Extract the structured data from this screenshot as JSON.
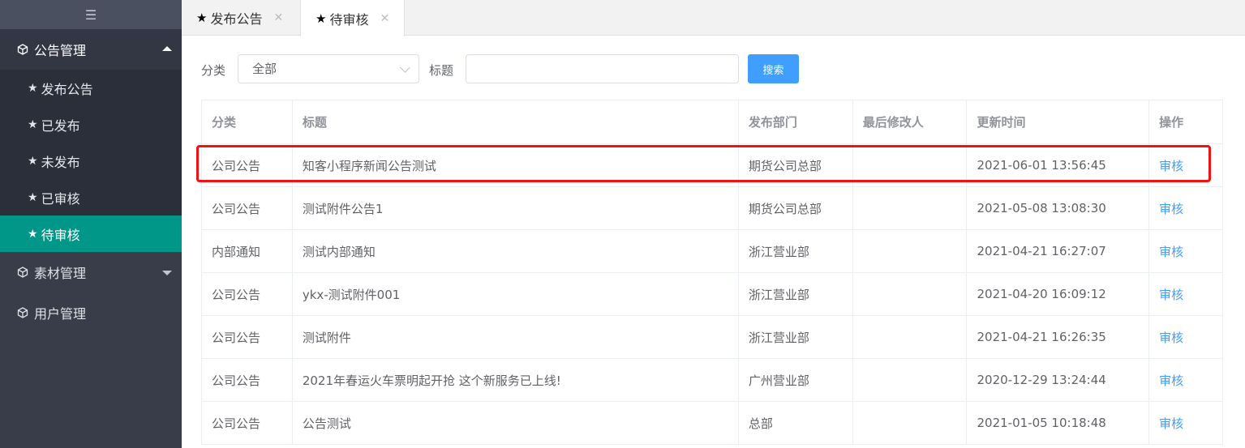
{
  "sidebar": {
    "toggle_icon": "menu-icon",
    "groups": [
      {
        "label": "公告管理",
        "icon": "cube-icon",
        "expanded": true,
        "items": [
          {
            "label": "发布公告",
            "icon": "star-icon"
          },
          {
            "label": "已发布",
            "icon": "star-icon"
          },
          {
            "label": "未发布",
            "icon": "star-icon"
          },
          {
            "label": "已审核",
            "icon": "star-icon"
          },
          {
            "label": "待审核",
            "icon": "star-icon",
            "active": true
          }
        ]
      },
      {
        "label": "素材管理",
        "icon": "cube-icon",
        "expanded": false
      },
      {
        "label": "用户管理",
        "icon": "cube-icon"
      }
    ]
  },
  "tabs": [
    {
      "label": "发布公告",
      "icon": "star-icon",
      "close": "✕"
    },
    {
      "label": "待审核",
      "icon": "star-icon",
      "close": "✕",
      "active": true
    }
  ],
  "search": {
    "category_label": "分类",
    "category_value": "全部",
    "title_label": "标题",
    "title_value": "",
    "button_label": "搜索"
  },
  "table": {
    "headers": [
      "分类",
      "标题",
      "发布部门",
      "最后修改人",
      "更新时间",
      "操作"
    ],
    "rows": [
      {
        "category": "公司公告",
        "title": "知客小程序新闻公告测试",
        "dept": "期货公司总部",
        "modifier": "",
        "time": "2021-06-01 13:56:45",
        "action": "审核"
      },
      {
        "category": "公司公告",
        "title": "测试附件公告1",
        "dept": "期货公司总部",
        "modifier": "",
        "time": "2021-05-08 13:08:30",
        "action": "审核"
      },
      {
        "category": "内部通知",
        "title": "测试内部通知",
        "dept": "浙江营业部",
        "modifier": "",
        "time": "2021-04-21 16:27:07",
        "action": "审核"
      },
      {
        "category": "公司公告",
        "title": "ykx-测试附件001",
        "dept": "浙江营业部",
        "modifier": "",
        "time": "2021-04-20 16:09:12",
        "action": "审核"
      },
      {
        "category": "公司公告",
        "title": "测试附件",
        "dept": "浙江营业部",
        "modifier": "",
        "time": "2021-04-21 16:26:35",
        "action": "审核"
      },
      {
        "category": "公司公告",
        "title": "2021年春运火车票明起开抢 这个新服务已上线!",
        "dept": "广州营业部",
        "modifier": "",
        "time": "2020-12-29 13:24:44",
        "action": "审核"
      },
      {
        "category": "公司公告",
        "title": "公告测试",
        "dept": "总部",
        "modifier": "",
        "time": "2021-01-05 10:18:48",
        "action": "审核"
      }
    ]
  },
  "colors": {
    "sidebar_bg": "#393d49",
    "active_item": "#009688",
    "primary": "#409eff",
    "highlight_border": "#f21212"
  }
}
